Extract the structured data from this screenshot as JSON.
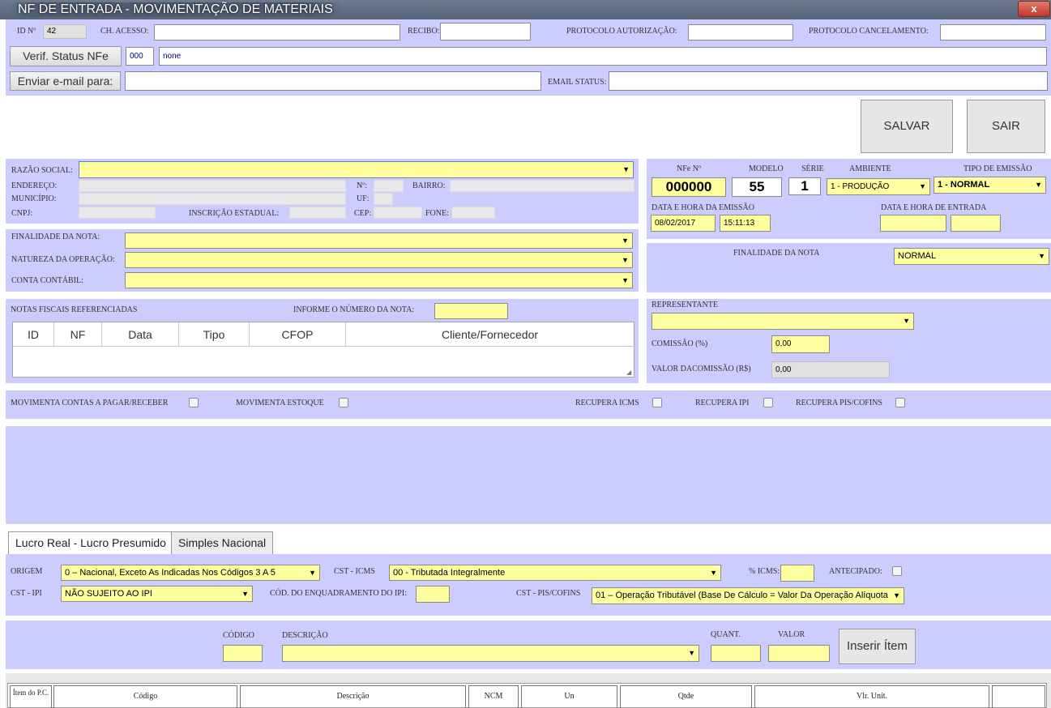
{
  "window": {
    "title": "NF DE ENTRADA - MOVIMENTAÇÃO DE MATERIAIS",
    "close_label": "x"
  },
  "header": {
    "id_label": "ID Nº",
    "id_value": "42",
    "ch_acesso_label": "CH. ACESSO:",
    "recibo_label": "RECIBO:",
    "protocolo_autorizacao_label": "PROTOCOLO AUTORIZAÇÃO:",
    "protocolo_cancelamento_label": "PROTOCOLO CANCELAMENTO:",
    "verif_button": "Verif. Status NFe",
    "status_code": "000",
    "status_text": "none",
    "email_button": "Enviar e-mail para:",
    "email_status_label": "EMAIL STATUS:"
  },
  "actions": {
    "save": "SALVAR",
    "exit": "SAIR"
  },
  "cliente": {
    "razao_social_label": "RAZÃO SOCIAL:",
    "endereco_label": "ENDEREÇO:",
    "numero_label": "Nº:",
    "bairro_label": "BAIRRO:",
    "municipio_label": "MUNICÍPIO:",
    "uf_label": "UF:",
    "cnpj_label": "CNPJ:",
    "ie_label": "INSCRIÇÃO ESTADUAL:",
    "cep_label": "CEP:",
    "fone_label": "FONE:"
  },
  "nfe": {
    "nfe_label": "NFe Nº",
    "nfe_value": "000000",
    "modelo_label": "MODELO",
    "modelo_value": "55",
    "serie_label": "SÉRIE",
    "serie_value": "1",
    "ambiente_label": "AMBIENTE",
    "ambiente_value": "1 - PRODUÇÃO",
    "tipo_emissao_label": "TIPO DE EMISSÃO",
    "tipo_emissao_value": "1 - NORMAL",
    "data_emissao_label": "DATA E HORA DA EMISSÃO",
    "data_emissao": "08/02/2017",
    "hora_emissao": "15:11:13",
    "data_entrada_label": "DATA E HORA DE ENTRADA",
    "finalidade_label": "FINALIDADE DA NOTA",
    "finalidade_value": "NORMAL"
  },
  "operacao": {
    "finalidade_label": "FINALIDADE DA NOTA:",
    "natureza_label": "NATUREZA DA OPERAÇÃO:",
    "conta_label": "CONTA CONTÁBIL:"
  },
  "referenciadas": {
    "title": "NOTAS FISCAIS REFERENCIADAS",
    "informe_label": "INFORME O NÚMERO DA NOTA:",
    "columns": [
      "ID",
      "NF",
      "Data",
      "Tipo",
      "CFOP",
      "Cliente/Fornecedor"
    ]
  },
  "representante": {
    "label": "REPRESENTANTE",
    "comissao_label": "COMISSÃO (%)",
    "comissao_value": "0,00",
    "valor_label": "VALOR DACOMISSÃO (R$)",
    "valor_value": "0,00"
  },
  "flags": {
    "contas_label": "MOVIMENTA CONTAS A PAGAR/RECEBER",
    "estoque_label": "MOVIMENTA ESTOQUE",
    "icms_label": "RECUPERA ICMS",
    "ipi_label": "RECUPERA IPI",
    "pis_label": "RECUPERA PIS/COFINS"
  },
  "tabs": [
    "Lucro Real - Lucro Presumido",
    "Simples Nacional"
  ],
  "tributos": {
    "origem_label": "ORIGEM",
    "origem_value": "0 – Nacional, Exceto As Indicadas Nos Códigos 3 A 5",
    "cst_icms_label": "CST - ICMS",
    "cst_icms_value": "00 - Tributada Integralmente",
    "pct_icms_label": "% ICMS:",
    "antecipado_label": "ANTECIPADO:",
    "cst_ipi_label": "CST - IPI",
    "cst_ipi_value": "NÃO SUJEITO AO IPI",
    "enquadramento_label": "CÓD. DO ENQUADRAMENTO DO IPI:",
    "cst_pis_label": "CST - PIS/COFINS",
    "cst_pis_value": "01 – Operação Tributável (Base De Cálculo = Valor Da Operação Alíquota"
  },
  "item": {
    "codigo_label": "CÓDIGO",
    "descricao_label": "DESCRIÇÃO",
    "quant_label": "QUANT.",
    "valor_label": "VALOR",
    "insert_button": "Inserir Ítem"
  },
  "items_table": {
    "columns": [
      "Ítem do P.C.",
      "Código",
      "Descrição",
      "NCM",
      "Un",
      "Qtde",
      "Vlr. Unit.",
      ""
    ]
  }
}
